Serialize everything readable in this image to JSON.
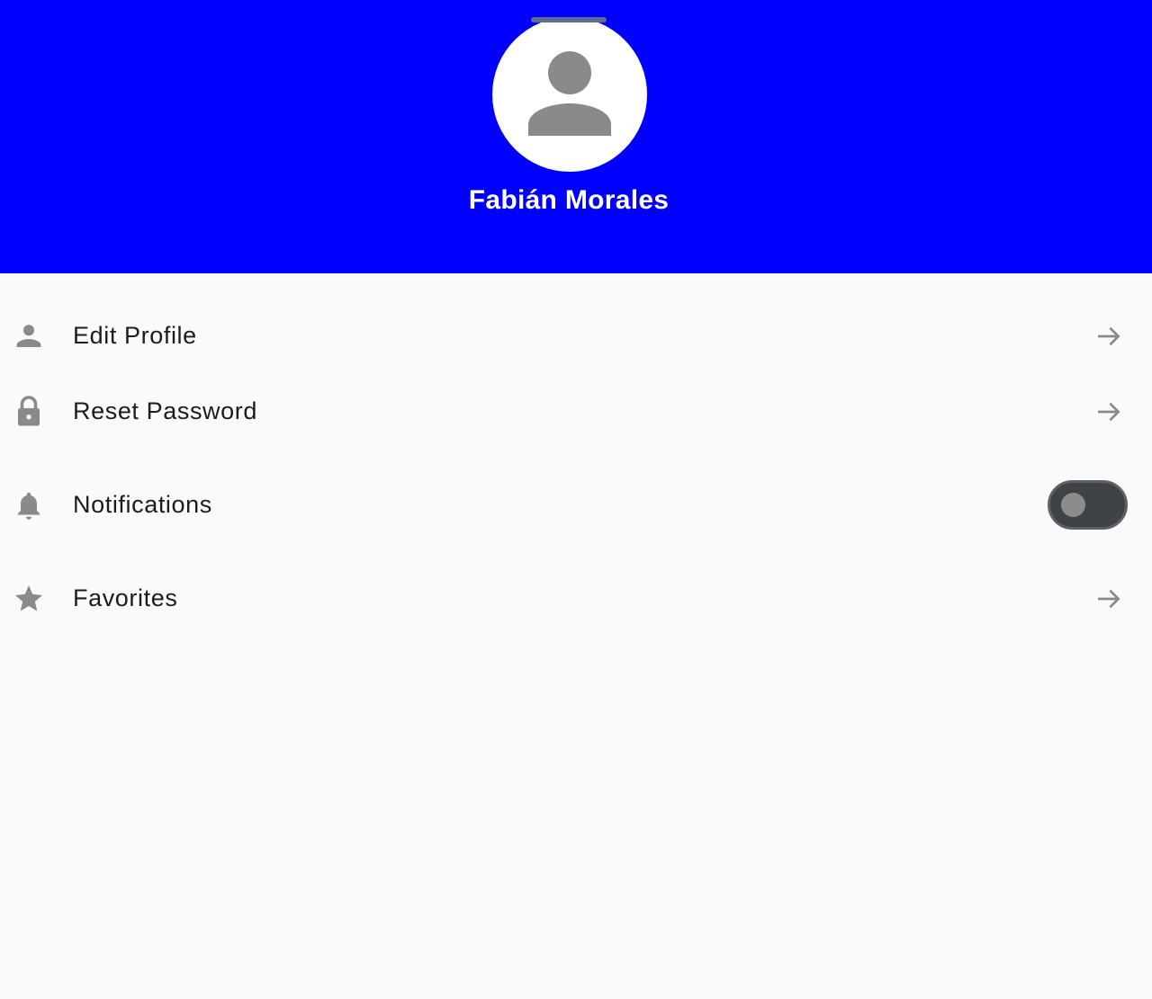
{
  "header": {
    "background_color": "#0000ff",
    "user_name": "Fabián Morales",
    "avatar_icon": "person-icon"
  },
  "menu": {
    "items": [
      {
        "label": "Edit Profile",
        "icon": "person-icon",
        "trailing": "arrow-right-icon"
      },
      {
        "label": "Reset Password",
        "icon": "lock-icon",
        "trailing": "arrow-right-icon"
      },
      {
        "label": "Notifications",
        "icon": "bell-icon",
        "trailing": "toggle",
        "toggle_on": false
      },
      {
        "label": "Favorites",
        "icon": "star-icon",
        "trailing": "arrow-right-icon"
      }
    ]
  },
  "colors": {
    "icon_gray": "#8a8a8a",
    "background": "#fafafa",
    "toggle_track": "#3f4247"
  }
}
